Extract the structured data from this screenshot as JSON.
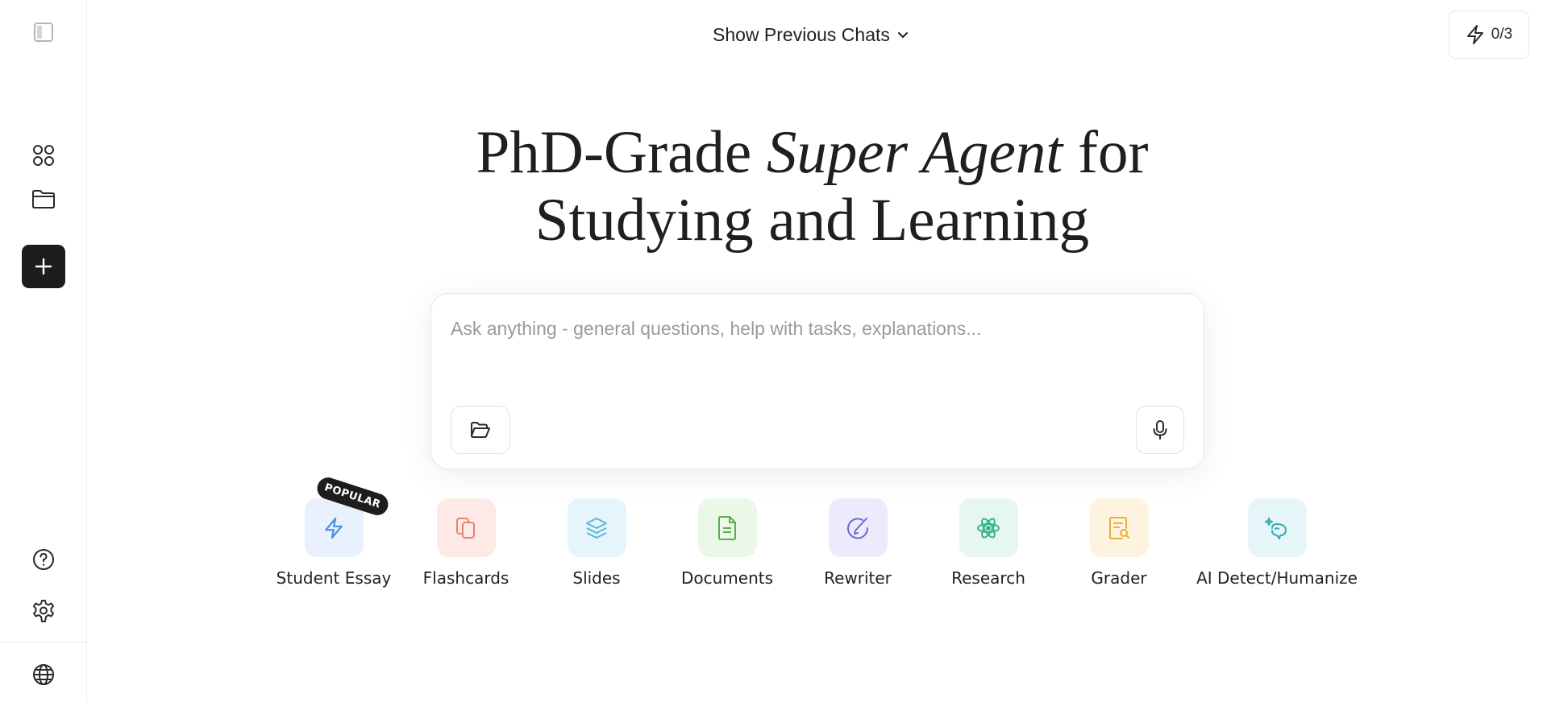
{
  "header": {
    "previous_chats_label": "Show Previous Chats",
    "credits": "0/3"
  },
  "hero": {
    "line1_before": "PhD-Grade ",
    "line1_italic": "Super Agent",
    "line1_after": " for",
    "line2": "Studying and Learning"
  },
  "prompt": {
    "placeholder": "Ask anything - general questions, help with tasks, explanations...",
    "value": ""
  },
  "sidebar": {
    "icons": [
      "panel-toggle-icon",
      "apps-grid-icon",
      "folder-icon",
      "plus-icon",
      "help-icon",
      "settings-icon",
      "globe-icon"
    ]
  },
  "tools": [
    {
      "label": "Student Essay",
      "icon": "bolt-icon",
      "bg": "#e8f1fd",
      "color": "#4a8fe0",
      "badge": "POPULAR"
    },
    {
      "label": "Flashcards",
      "icon": "cards-icon",
      "bg": "#fde9e5",
      "color": "#e8846e"
    },
    {
      "label": "Slides",
      "icon": "layers-icon",
      "bg": "#e6f5fb",
      "color": "#5bb6d9"
    },
    {
      "label": "Documents",
      "icon": "document-icon",
      "bg": "#ebf7e7",
      "color": "#5aad52"
    },
    {
      "label": "Rewriter",
      "icon": "rewrite-icon",
      "bg": "#ecebfb",
      "color": "#6f67d6"
    },
    {
      "label": "Research",
      "icon": "atom-icon",
      "bg": "#e6f7f0",
      "color": "#35b286"
    },
    {
      "label": "Grader",
      "icon": "grader-icon",
      "bg": "#fdf3e0",
      "color": "#e4b23a"
    },
    {
      "label": "AI Detect/Humanize",
      "icon": "humanize-icon",
      "bg": "#e6f6f8",
      "color": "#3aa9b7"
    }
  ]
}
